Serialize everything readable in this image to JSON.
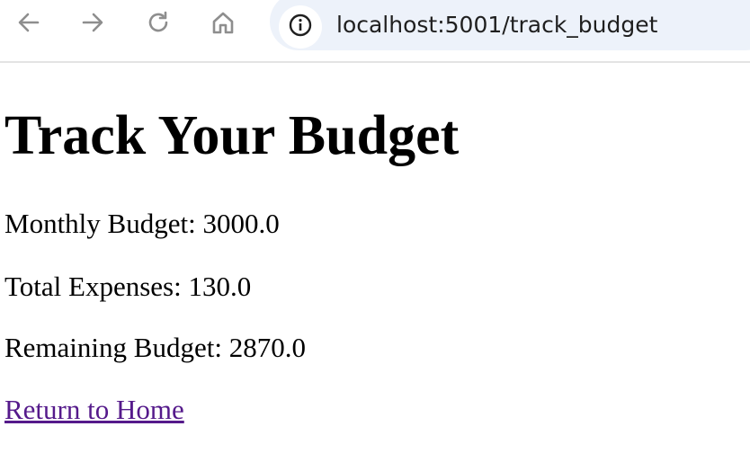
{
  "browser": {
    "url": "localhost:5001/track_budget",
    "nav_icons": [
      "back-arrow-icon",
      "forward-arrow-icon",
      "reload-icon",
      "home-icon",
      "info-icon"
    ]
  },
  "page": {
    "title": "Track Your Budget",
    "monthly_budget": {
      "label": "Monthly Budget: ",
      "value": "3000.0"
    },
    "total_expenses": {
      "label": "Total Expenses: ",
      "value": "130.0"
    },
    "remaining_budget": {
      "label": "Remaining Budget: ",
      "value": "2870.0"
    },
    "home_link": "Return to Home"
  },
  "colors": {
    "omnibox_bg": "#edf2fa",
    "icon_gray": "#8e8e8e",
    "visited_link": "#551a8b"
  }
}
